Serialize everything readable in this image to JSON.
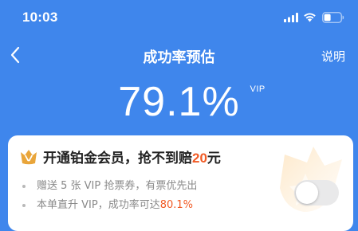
{
  "status_bar": {
    "time": "10:03"
  },
  "nav": {
    "title": "成功率预估",
    "help_label": "说明"
  },
  "hero": {
    "rate": "79.1%",
    "vip_tag": "VIP"
  },
  "card": {
    "title_prefix": "开通铂金会员，抢不到赔",
    "amount": "20",
    "title_suffix": "元",
    "benefits": [
      {
        "text": "赠送 5 张 VIP 抢票券，有票优先出"
      },
      {
        "text": "本单直升 VIP，成功率可达 ",
        "highlight": "80.1%"
      }
    ],
    "toggle_on": false
  },
  "colors": {
    "background": "#3f86ec",
    "accent_orange": "#f15a24",
    "crown_gold": "#e9a53a"
  },
  "icons": {
    "signal": "signal-icon",
    "wifi": "wifi-icon",
    "battery": "battery-icon",
    "back": "chevron-left-icon",
    "crown": "crown-icon"
  }
}
